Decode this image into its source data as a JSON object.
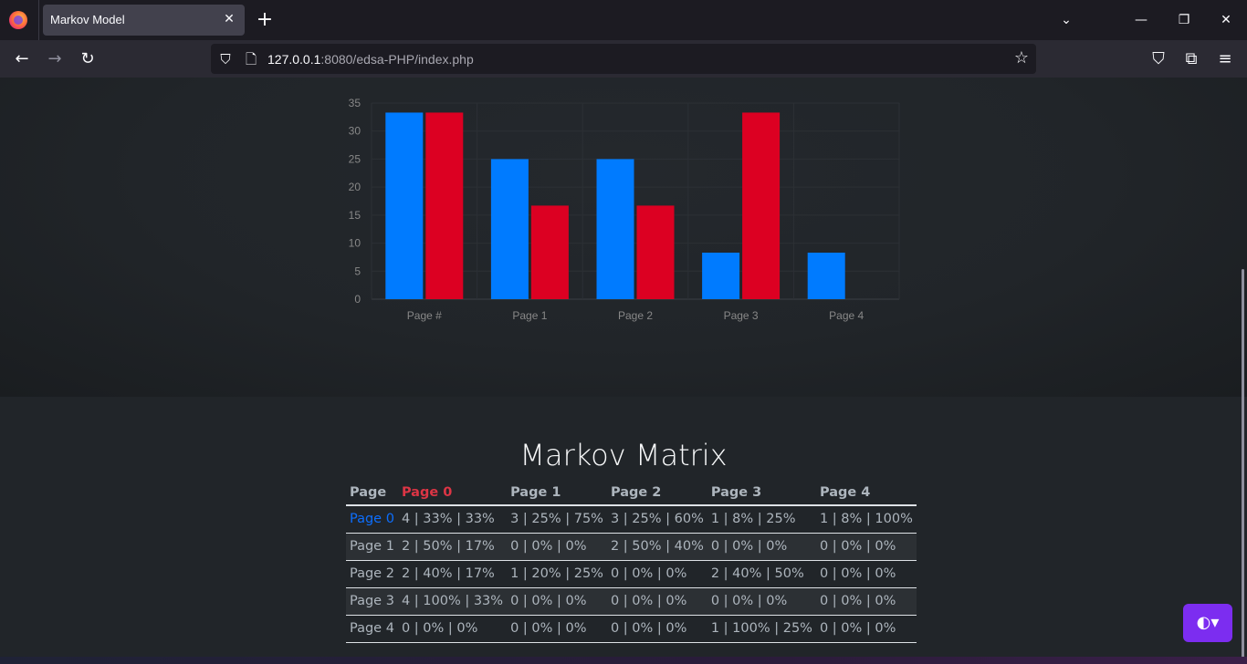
{
  "browser": {
    "tab_title": "Markov Model",
    "url_host": "127.0.0.1",
    "url_rest": ":8080/edsa-PHP/index.php"
  },
  "icons": [
    "firefox-logo-icon",
    "close-icon",
    "plus-icon",
    "chevron-down-icon",
    "minimize-icon",
    "restore-icon",
    "close-window-icon",
    "back-arrow-icon",
    "forward-arrow-icon",
    "reload-icon",
    "shield-icon",
    "page-icon",
    "star-icon",
    "pocket-icon",
    "extensions-icon",
    "menu-icon",
    "contrast-icon"
  ],
  "colors": {
    "blue_series": "#007bff",
    "red_series": "#dc0022",
    "theme_button": "#7c2df0"
  },
  "chart_data": {
    "type": "bar",
    "categories": [
      "Page #",
      "Page 1",
      "Page 2",
      "Page 3",
      "Page 4"
    ],
    "series": [
      {
        "values": [
          33.3,
          25,
          25,
          8.3,
          8.3
        ]
      },
      {
        "values": [
          33.3,
          16.7,
          16.7,
          33.3,
          0
        ]
      }
    ],
    "yticks": [
      0,
      5,
      10,
      15,
      20,
      25,
      30,
      35
    ],
    "ylim": [
      0,
      35
    ],
    "grid": true
  },
  "matrix": {
    "title": "Markov Matrix",
    "headers": [
      "Page",
      "Page 0",
      "Page 1",
      "Page 2",
      "Page 3",
      "Page 4"
    ],
    "rows": [
      [
        "Page 0",
        "4 | 33% | 33%",
        "3 | 25% | 75%",
        "3 | 25% | 60%",
        "1 | 8% | 25%",
        "1 | 8% | 100%"
      ],
      [
        "Page 1",
        "2 | 50% | 17%",
        "0 | 0% | 0%",
        "2 | 50% | 40%",
        "0 | 0% | 0%",
        "0 | 0% | 0%"
      ],
      [
        "Page 2",
        "2 | 40% | 17%",
        "1 | 20% | 25%",
        "0 | 0% | 0%",
        "2 | 40% | 50%",
        "0 | 0% | 0%"
      ],
      [
        "Page 3",
        "4 | 100% | 33%",
        "0 | 0% | 0%",
        "0 | 0% | 0%",
        "0 | 0% | 0%",
        "0 | 0% | 0%"
      ],
      [
        "Page 4",
        "0 | 0% | 0%",
        "0 | 0% | 0%",
        "0 | 0% | 0%",
        "1 | 100% | 25%",
        "0 | 0% | 0%"
      ]
    ]
  }
}
